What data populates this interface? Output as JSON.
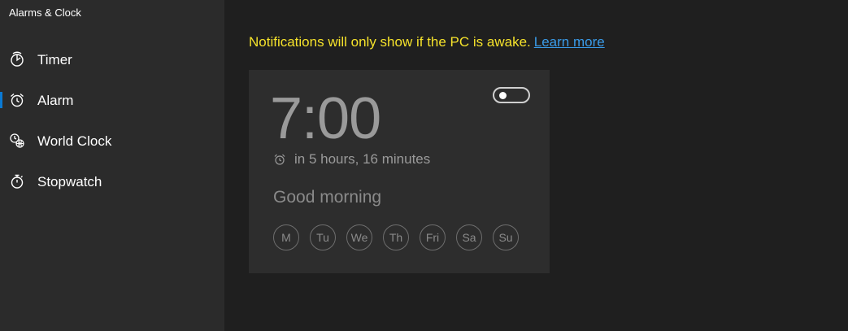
{
  "app": {
    "title": "Alarms & Clock"
  },
  "sidebar": {
    "items": [
      {
        "label": "Timer",
        "icon": "timer-icon",
        "selected": false
      },
      {
        "label": "Alarm",
        "icon": "alarm-clock-icon",
        "selected": true
      },
      {
        "label": "World Clock",
        "icon": "world-clock-icon",
        "selected": false
      },
      {
        "label": "Stopwatch",
        "icon": "stopwatch-icon",
        "selected": false
      }
    ],
    "accent_color": "#0a7ad4"
  },
  "notice": {
    "text": "Notifications will only show if the PC is awake.",
    "link_label": "Learn more",
    "text_color": "#f5e22b",
    "link_color": "#3a9be8"
  },
  "alarm": {
    "time": "7:00",
    "remaining": "in 5 hours, 16 minutes",
    "name": "Good morning",
    "enabled": false,
    "days": [
      "M",
      "Tu",
      "We",
      "Th",
      "Fri",
      "Sa",
      "Su"
    ]
  }
}
